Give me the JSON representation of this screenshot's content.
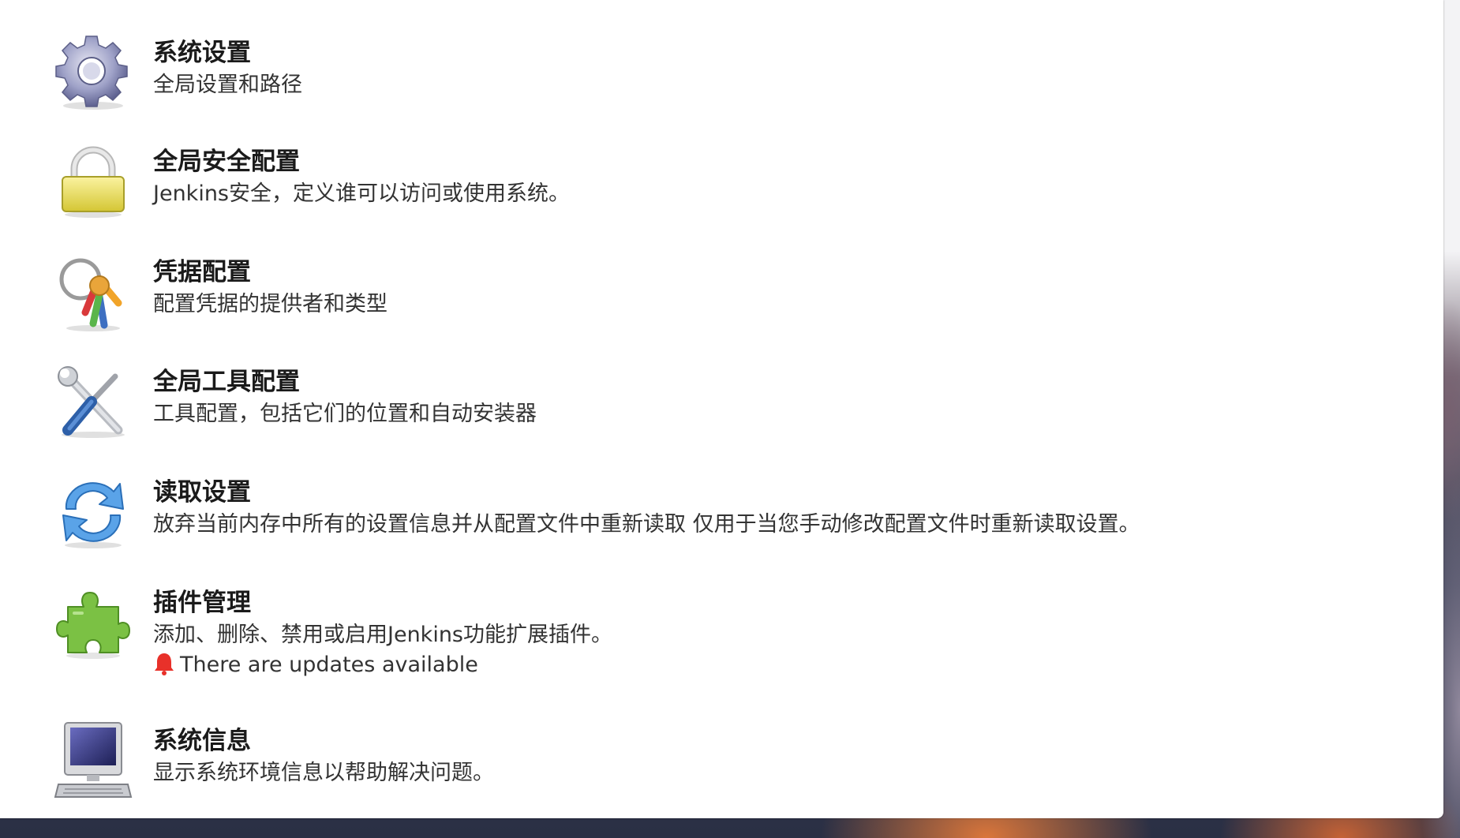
{
  "items": [
    {
      "icon": "gear-icon",
      "title": "系统设置",
      "desc": "全局设置和路径"
    },
    {
      "icon": "lock-icon",
      "title": "全局安全配置",
      "desc": "Jenkins安全，定义谁可以访问或使用系统。"
    },
    {
      "icon": "keys-icon",
      "title": "凭据配置",
      "desc": "配置凭据的提供者和类型"
    },
    {
      "icon": "tools-icon",
      "title": "全局工具配置",
      "desc": "工具配置，包括它们的位置和自动安装器"
    },
    {
      "icon": "reload-icon",
      "title": "读取设置",
      "desc": "放弃当前内存中所有的设置信息并从配置文件中重新读取 仅用于当您手动修改配置文件时重新读取设置。"
    },
    {
      "icon": "puzzle-icon",
      "title": "插件管理",
      "desc": "添加、删除、禁用或启用Jenkins功能扩展插件。",
      "notice": "There are updates available",
      "notice_icon": "bell-icon"
    },
    {
      "icon": "computer-icon",
      "title": "系统信息",
      "desc": "显示系统环境信息以帮助解决问题。"
    }
  ],
  "colors": {
    "notice_bell": "#e8312a",
    "lock_body": "#e6d84a",
    "puzzle": "#7bc144"
  }
}
